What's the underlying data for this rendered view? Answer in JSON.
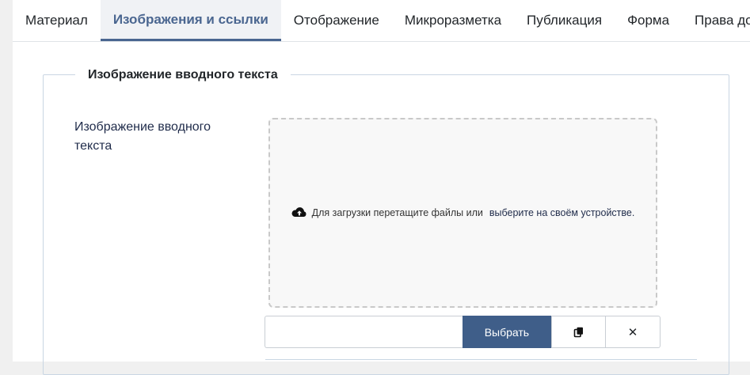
{
  "tabs": [
    {
      "label": "Материал",
      "active": false
    },
    {
      "label": "Изображения и ссылки",
      "active": true
    },
    {
      "label": "Отображение",
      "active": false
    },
    {
      "label": "Микроразметка",
      "active": false
    },
    {
      "label": "Публикация",
      "active": false
    },
    {
      "label": "Форма",
      "active": false
    },
    {
      "label": "Права доступа",
      "active": false
    }
  ],
  "fieldset": {
    "legend": "Изображение вводного текста",
    "field_label": "Изображение вводного текста"
  },
  "dropzone": {
    "icon": "cloud-upload-icon",
    "text": "Для загрузки перетащите файлы или",
    "link": "выберите на своём устройстве."
  },
  "media": {
    "value": "",
    "select_label": "Выбрать",
    "copy_icon": "copy-icon",
    "clear_label": "✕"
  },
  "colors": {
    "accent": "#4a6690",
    "button": "#3f5e89",
    "border": "#c9d6e3"
  }
}
